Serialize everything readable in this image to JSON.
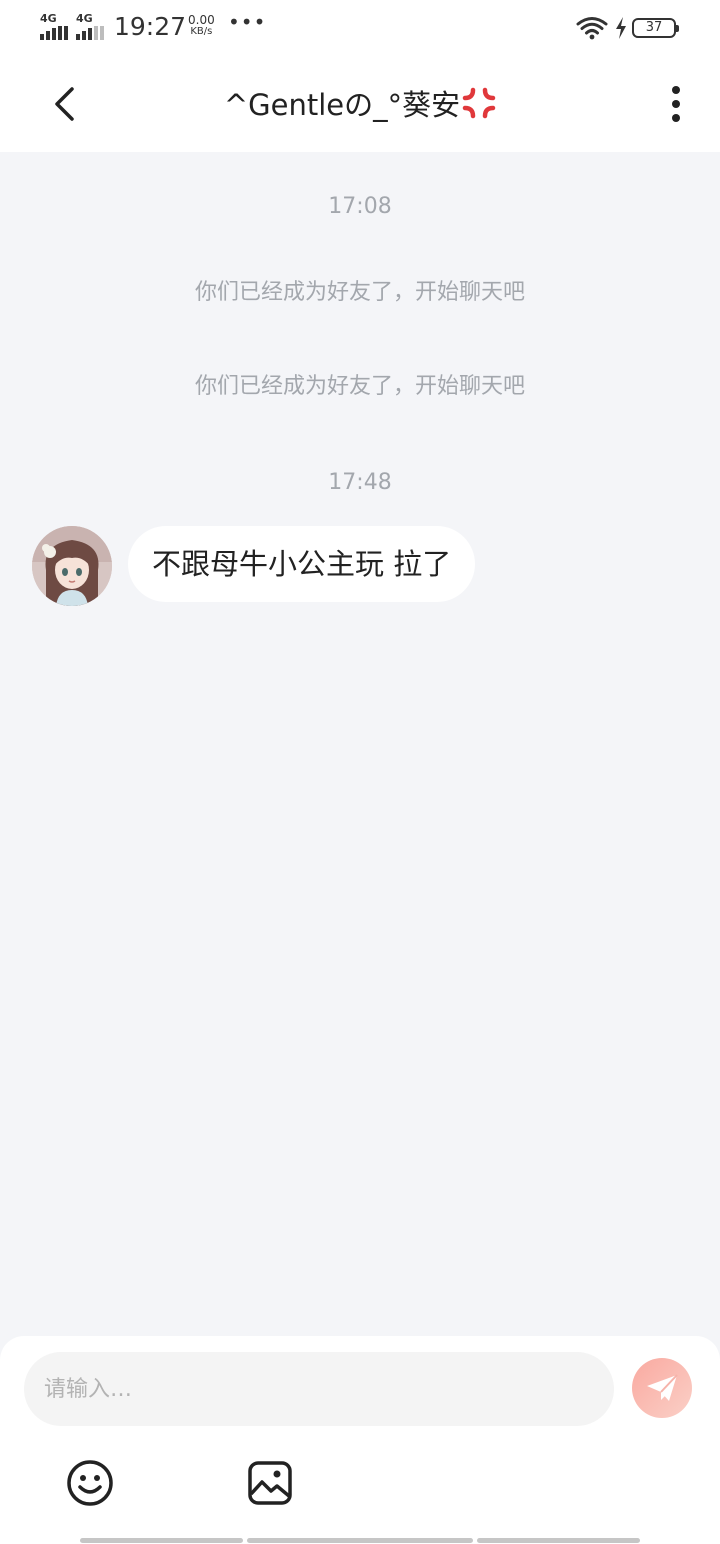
{
  "status_bar": {
    "network_1": "4G",
    "network_2": "4G",
    "time": "19:27",
    "speed_value": "0.00",
    "speed_unit": "KB/s",
    "more": "•••",
    "battery": "37"
  },
  "header": {
    "title": "^Gentleの_°葵安",
    "title_emoji": "anger-symbol-icon",
    "back_icon": "chevron-left-icon",
    "menu_icon": "more-vertical-icon"
  },
  "chat": {
    "timestamp_1": "17:08",
    "system_message_1": "你们已经成为好友了，开始聊天吧",
    "system_message_2": "你们已经成为好友了，开始聊天吧",
    "timestamp_2": "17:48",
    "message_1": "不跟母牛小公主玩 拉了"
  },
  "composer": {
    "placeholder": "请输入…",
    "value": "",
    "send_icon": "paper-plane-icon",
    "emoji_icon": "smiley-icon",
    "image_icon": "image-icon"
  },
  "colors": {
    "background": "#f4f5f8",
    "bubble": "#ffffff",
    "muted_text": "#a3a7ad",
    "send_accent": "#f9a9a0"
  }
}
